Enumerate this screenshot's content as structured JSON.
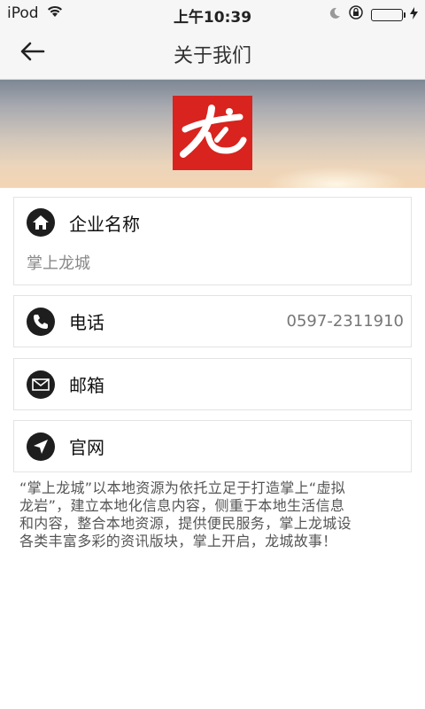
{
  "status_bar": {
    "carrier": "iPod",
    "time": "上午10:39",
    "battery_color": "#4cd964"
  },
  "nav": {
    "back_icon": "arrow-left-icon",
    "title": "关于我们"
  },
  "banner": {
    "logo_text": "龙",
    "logo_color": "#d8231f"
  },
  "company": {
    "icon": "home-icon",
    "label": "企业名称",
    "value": "掌上龙城"
  },
  "phone": {
    "icon": "phone-icon",
    "label": "电话",
    "value": "0597-2311910"
  },
  "email": {
    "icon": "mail-icon",
    "label": "邮箱",
    "value": ""
  },
  "website": {
    "icon": "location-arrow-icon",
    "label": "官网",
    "value": ""
  },
  "description": {
    "line1": "“掌上龙城”以本地资源为依托立足于打造掌上“虚拟",
    "line2": "龙岩”，建立本地化信息内容，侧重于本地生活信息",
    "line3": "和内容，整合本地资源，提供便民服务，掌上龙城设",
    "line4": "各类丰富多彩的资讯版块，掌上开启，龙城故事！"
  }
}
